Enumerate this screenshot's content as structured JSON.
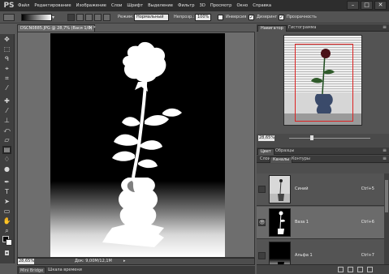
{
  "app": {
    "logo": "PS",
    "menu": [
      "Файл",
      "Редактирование",
      "Изображение",
      "Слои",
      "Шрифт",
      "Выделение",
      "Фильтр",
      "3D",
      "Просмотр",
      "Окно",
      "Справка"
    ],
    "window_controls": [
      "–",
      "□",
      "✕"
    ]
  },
  "options_bar": {
    "mode_label": "Режим:",
    "mode_value": "Нормальный",
    "opacity_label": "Непрозр.:",
    "opacity_value": "100%",
    "inversion_label": "Инверсия",
    "dither_label": "Дизеринг",
    "dither_checked": true,
    "transparency_label": "Прозрачность",
    "transparency_checked": true
  },
  "document": {
    "tab_title": "DSCN0885.JPG @ 28,7% (Вася 1/8) *",
    "close_glyph": "×",
    "zoom": "28,65%",
    "doc_info": "Док: 9,00M/12,1M",
    "status_arrow": "▸"
  },
  "bottom_tabs": [
    "Mini Bridge",
    "Шкала времени"
  ],
  "panels": {
    "navigator_tabs": [
      "Навигатор",
      "Гистограмма"
    ],
    "navigator_zoom": "28,65%",
    "color_tabs": [
      "Цвет",
      "Образцы"
    ],
    "layers_tabs": [
      "Слои",
      "Каналы",
      "Контуры"
    ],
    "panel_menu_glyph": "≡"
  },
  "channels": [
    {
      "name": "Синий",
      "shortcut": "Ctrl+5",
      "visible": false,
      "selected": false
    },
    {
      "name": "Ваза 1",
      "shortcut": "Ctrl+6",
      "visible": true,
      "selected": true
    },
    {
      "name": "Альфа 1",
      "shortcut": "Ctrl+7",
      "visible": false,
      "selected": false
    }
  ],
  "tools": [
    "move",
    "marquee",
    "lasso",
    "quick-select",
    "crop",
    "eyedropper",
    "spot-heal",
    "brush",
    "clone-stamp",
    "history-brush",
    "eraser",
    "gradient",
    "blur",
    "dodge",
    "pen",
    "type",
    "path-select",
    "rectangle",
    "hand",
    "zoom"
  ]
}
